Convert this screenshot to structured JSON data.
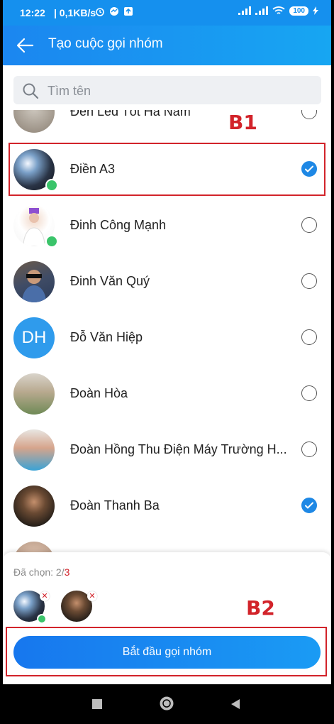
{
  "status_bar": {
    "time": "12:22",
    "network": "| 0,1KB/s",
    "battery": "100"
  },
  "appbar": {
    "title": "Tạo cuộc gọi nhóm"
  },
  "search": {
    "placeholder": "Tìm tên",
    "value": ""
  },
  "contacts": [
    {
      "name": "Đèn Led Tốt Hà Nam",
      "checked": false,
      "online": false
    },
    {
      "name": "Điền A3",
      "checked": true,
      "online": true
    },
    {
      "name": "Đinh Công Mạnh",
      "checked": false,
      "online": true
    },
    {
      "name": "Đinh Văn Quý",
      "checked": false,
      "online": false
    },
    {
      "name": "Đỗ Văn Hiệp",
      "checked": false,
      "online": false,
      "initials": "DH"
    },
    {
      "name": "Đoàn Hòa",
      "checked": false,
      "online": false
    },
    {
      "name": "Đoàn Hồng Thu Điện Máy Trường H...",
      "checked": false,
      "online": false
    },
    {
      "name": "Đoàn Thanh Ba",
      "checked": true,
      "online": false
    }
  ],
  "annotations": {
    "b1": "B1",
    "b2": "B2"
  },
  "selection": {
    "label": "Đã chọn: 2/",
    "max": "3"
  },
  "start_button": {
    "label": "Bắt đầu gọi nhóm"
  },
  "colors": {
    "primary": "#1590ee",
    "check": "#1e88e5",
    "online": "#3ac46a",
    "annotation": "#d2232a"
  }
}
